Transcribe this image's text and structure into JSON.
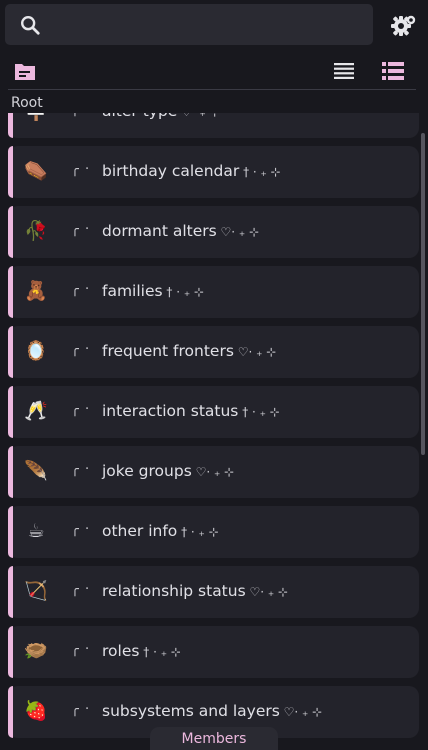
{
  "search": {
    "placeholder": "",
    "value": ""
  },
  "breadcrumb": {
    "label": "Root"
  },
  "colors": {
    "accent": "#ecb8de",
    "row_bg": "#23232b",
    "bg": "#18181e"
  },
  "members": [
    {
      "emoji": "🪧",
      "deco": "╭ ·",
      "name": "alter type",
      "suffix": " ♡· ₊ ⊹"
    },
    {
      "emoji": "⚰️",
      "deco": "╭ ·",
      "name": "birthday calendar",
      "suffix": " † · ₊ ⊹"
    },
    {
      "emoji": "🥀",
      "deco": "╭ ·",
      "name": "dormant alters",
      "suffix": " ♡· ₊ ⊹"
    },
    {
      "emoji": "🧸",
      "deco": "╭ ·",
      "name": "families",
      "suffix": " † · ₊ ⊹"
    },
    {
      "emoji": "🪞",
      "deco": "╭ ·",
      "name": "frequent fronters",
      "suffix": " ♡· ₊ ⊹"
    },
    {
      "emoji": "🥂",
      "deco": "╭ ·",
      "name": "interaction status",
      "suffix": " † · ₊ ⊹"
    },
    {
      "emoji": "🪶",
      "deco": "╭ ·",
      "name": "joke groups",
      "suffix": " ♡· ₊ ⊹"
    },
    {
      "emoji": "☕",
      "deco": "╭ ·",
      "name": "other info",
      "suffix": " † · ₊ ⊹"
    },
    {
      "emoji": "🏹",
      "deco": "╭ ·",
      "name": "relationship status",
      "suffix": " ♡· ₊ ⊹"
    },
    {
      "emoji": "🪹",
      "deco": "╭ ·",
      "name": "roles",
      "suffix": " † · ₊ ⊹"
    },
    {
      "emoji": "🍓",
      "deco": "╭ ·",
      "name": "subsystems and layers",
      "suffix": " ♡· ₊ ⊹"
    }
  ],
  "bottom_tab": {
    "label": "Members"
  },
  "icons": {
    "search": "search-icon",
    "settings": "settings-gear-icon",
    "folder": "folder-icon",
    "list_view": "list-view-icon",
    "detail_view": "detail-list-view-icon"
  }
}
